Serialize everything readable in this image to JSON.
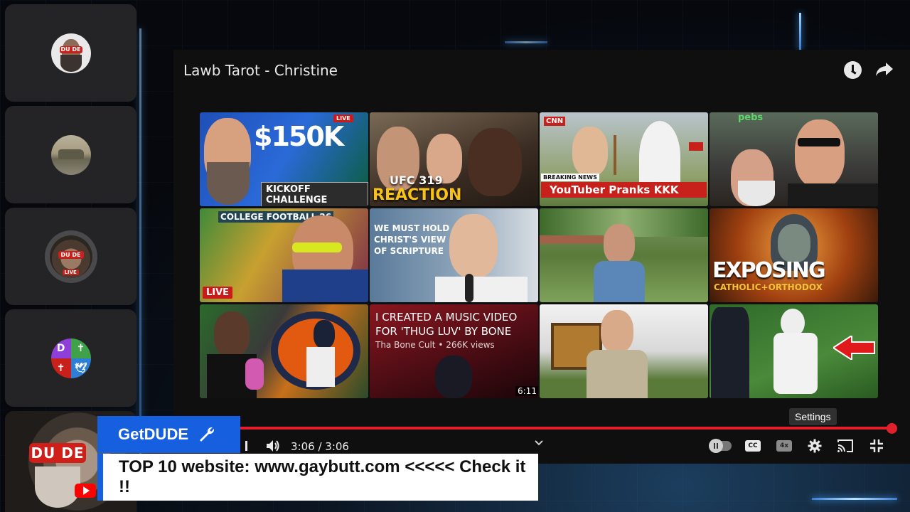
{
  "player": {
    "title": "Lawb Tarot - Christine",
    "time": "3:06 / 3:06",
    "tooltip": "Settings",
    "quality_badge": "4x",
    "progress_fraction": 1.0
  },
  "end_screen": [
    {
      "text": "$150K",
      "badge": "LIVE",
      "subtext": "KICKOFF CHALLENGE"
    },
    {
      "text": "UFC 319",
      "subtext": "REACTION"
    },
    {
      "text": "CNN",
      "badge": "BREAKING NEWS",
      "subtext": "YouTuber Pranks KKK"
    },
    {
      "text": "pebs"
    },
    {
      "text": "COLLEGE FOOTBALL 26",
      "badge": "LIVE"
    },
    {
      "text": "WE MUST HOLD CHRIST'S VIEW OF SCRIPTURE"
    },
    {
      "text": ""
    },
    {
      "text": "EXPOSING",
      "subtext": "CATHOLIC+ORTHODOX"
    },
    {
      "text": ""
    },
    {
      "text": "I CREATED A MUSIC VIDEO FOR 'THUG LUV' BY BONE",
      "subtext": "Tha Bone Cult • 266K views",
      "duration": "6:11"
    },
    {
      "text": ""
    },
    {
      "text": ""
    }
  ],
  "participants": [
    {
      "name": "dude-avatar",
      "label": "DU DE"
    },
    {
      "name": "car-avatar"
    },
    {
      "name": "live-avatar",
      "label": "DU DE",
      "badge": "LIVE"
    },
    {
      "name": "quad-avatar",
      "label": "D"
    }
  ],
  "overlay": {
    "brand": "GetDUDE",
    "ticker": "TOP 10 website: www.gaybutt.com <<<<< Check it !!",
    "cam_label": "DU DE"
  }
}
